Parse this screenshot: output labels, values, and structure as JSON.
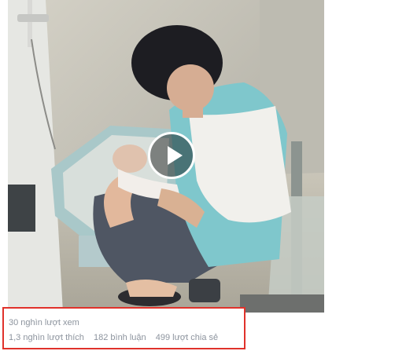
{
  "video": {
    "play_icon": "play-icon"
  },
  "stats": {
    "views": "30 nghìn lượt xem",
    "likes": "1,3 nghìn lượt thích",
    "comments": "182 bình luận",
    "shares": "499 lượt chia sẻ"
  },
  "colors": {
    "highlight_border": "#e0322b",
    "stat_text": "#8d949e"
  }
}
